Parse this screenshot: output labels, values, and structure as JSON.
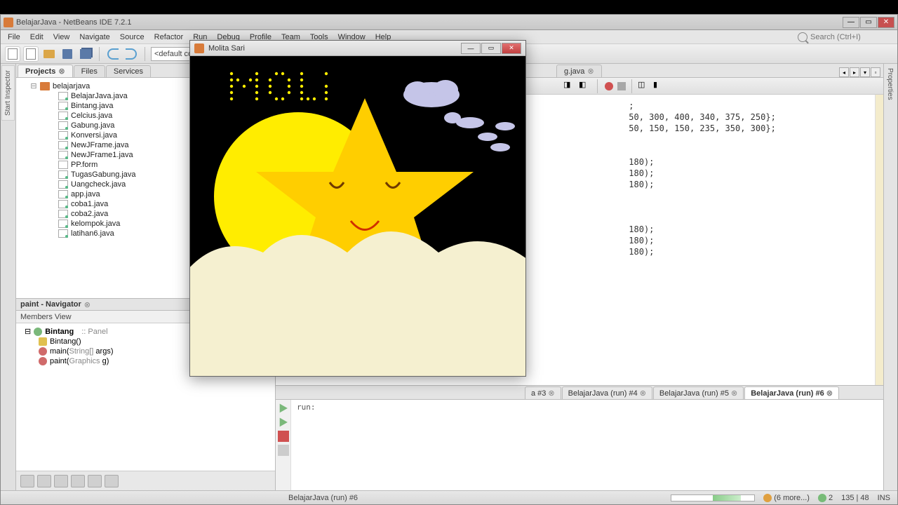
{
  "window": {
    "title": "BelajarJava - NetBeans IDE 7.2.1"
  },
  "menu": [
    "File",
    "Edit",
    "View",
    "Navigate",
    "Source",
    "Refactor",
    "Run",
    "Debug",
    "Profile",
    "Team",
    "Tools",
    "Window",
    "Help"
  ],
  "search_placeholder": "Search (Ctrl+I)",
  "config": "<default confi",
  "left_tabs": {
    "active": "Projects",
    "others": [
      "Files",
      "Services"
    ]
  },
  "project": {
    "root": "belajarjava",
    "files": [
      "BelajarJava.java",
      "Bintang.java",
      "Celcius.java",
      "Gabung.java",
      "Konversi.java",
      "NewJFrame.java",
      "NewJFrame1.java",
      "PP.form",
      "TugasGabung.java",
      "Uangcheck.java",
      "app.java",
      "coba1.java",
      "coba2.java",
      "kelompok.java",
      "latihan6.java"
    ]
  },
  "navigator": {
    "title": "paint - Navigator",
    "members_label": "Members View",
    "class": "Bintang",
    "class_note": ":: Panel",
    "items": [
      {
        "n": "Bintang()",
        "t": "c"
      },
      {
        "n": "main(",
        "a": "String[]",
        "r": " args)",
        "t": "m"
      },
      {
        "n": "paint(",
        "a": "Graphics",
        "r": " g)",
        "t": "m"
      }
    ]
  },
  "editor_tab": "g.java",
  "code_lines": [
    ";",
    "50, 300, 400, 340, 375, 250};",
    "50, 150, 150, 235, 350, 300};",
    "",
    "",
    "180);",
    "180);",
    "180);",
    "",
    "",
    "",
    "180);",
    "180);",
    "180);"
  ],
  "output_tabs": [
    "a #3",
    "BelajarJava (run) #4",
    "BelajarJava (run) #5",
    "BelajarJava (run) #6"
  ],
  "output_active": 3,
  "output_text": "run:",
  "status": {
    "run": "BelajarJava (run) #6",
    "more": "(6 more...)",
    "err": "2",
    "pos": "135 | 48",
    "mode": "INS"
  },
  "app": {
    "title": "Molita Sari",
    "text": "MOLi"
  },
  "right_panel": "Properties",
  "left_panel": "Start Inspector"
}
